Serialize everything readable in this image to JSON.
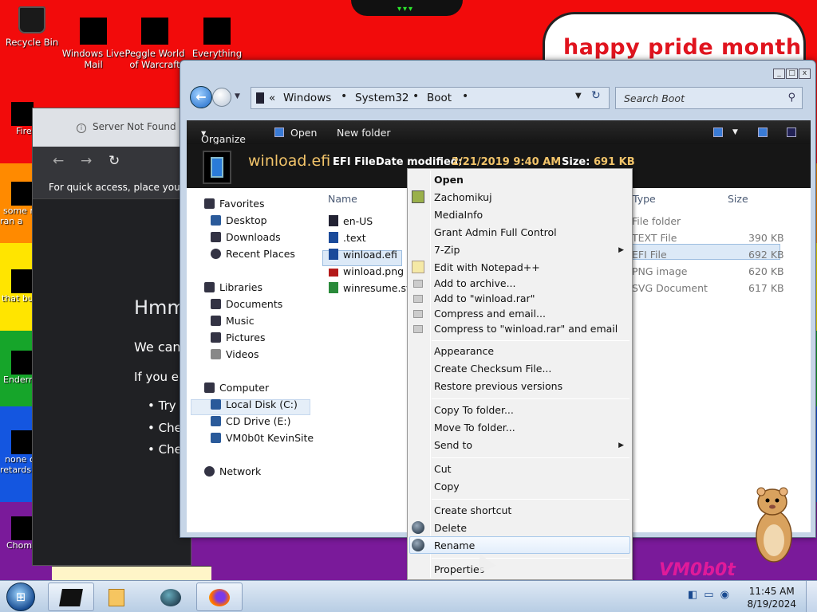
{
  "desktop": {
    "banner": "happy pride month",
    "icons": [
      {
        "label": "Recycle Bin",
        "icon": "recycle-bin-icon"
      },
      {
        "label": "Windows Live Mail",
        "icon": "mail-icon"
      },
      {
        "label": "Peggle World of Warcraft",
        "icon": "game-icon"
      },
      {
        "label": "Everything",
        "icon": "search-app-icon"
      }
    ],
    "left_icons": [
      "Fire",
      "some r ran a",
      "that bu",
      "Endern",
      "none o retards",
      "Chom"
    ],
    "watermark_text": "VM0b0t"
  },
  "browser": {
    "tab_title": "Server Not Found",
    "bookmarks_text": "For quick access, place your bo",
    "heading": "Hmm",
    "para1": "We can",
    "para2": "If you er",
    "bullets": [
      "Try a",
      "Che",
      "Che"
    ]
  },
  "explorer": {
    "breadcrumb": [
      "Windows",
      "System32",
      "Boot"
    ],
    "search_placeholder": "Search Boot",
    "toolbar": {
      "organize": "Organize",
      "open": "Open",
      "new_folder": "New folder"
    },
    "details": {
      "file_name": "winload.efi",
      "file_type": "EFI File",
      "date_label": "Date modified:",
      "date_value": "2/21/2019 9:40 AM",
      "size_label": "Size:",
      "size_value": "691 KB"
    },
    "nav": {
      "favorites": "Favorites",
      "desktop": "Desktop",
      "downloads": "Downloads",
      "recent": "Recent Places",
      "libraries": "Libraries",
      "documents": "Documents",
      "music": "Music",
      "pictures": "Pictures",
      "videos": "Videos",
      "computer": "Computer",
      "local_disk": "Local Disk (C:)",
      "cd_drive": "CD Drive (E:)",
      "vm": "VM0b0t KevinSite",
      "network": "Network"
    },
    "columns": {
      "name": "Name",
      "type": "Type",
      "size": "Size"
    },
    "files": [
      {
        "name": "en-US",
        "type": "File folder",
        "size": ""
      },
      {
        "name": ".text",
        "type": "TEXT File",
        "size": "390 KB"
      },
      {
        "name": "winload.efi",
        "type": "EFI File",
        "size": "692 KB"
      },
      {
        "name": "winload.png",
        "type": "PNG image",
        "size": "620 KB"
      },
      {
        "name": "winresume.svg",
        "type": "SVG Document",
        "size": "617 KB"
      }
    ]
  },
  "context_menu": {
    "open": "Open",
    "zachomikuj": "Zachomikuj",
    "mediainfo": "MediaInfo",
    "grant_admin": "Grant Admin Full Control",
    "zip": "7-Zip",
    "notepad": "Edit with Notepad++",
    "add_archive": "Add to archive...",
    "add_rar": "Add to \"winload.rar\"",
    "compress_email": "Compress and email...",
    "compress_rar_email": "Compress to \"winload.rar\" and email",
    "appearance": "Appearance",
    "checksum": "Create Checksum File...",
    "restore": "Restore previous versions",
    "copy_to": "Copy To folder...",
    "move_to": "Move To folder...",
    "send_to": "Send to",
    "cut": "Cut",
    "copy": "Copy",
    "shortcut": "Create shortcut",
    "delete": "Delete",
    "rename": "Rename",
    "properties": "Properties"
  },
  "taskbar": {
    "time": "11:45 AM",
    "date": "8/19/2024"
  }
}
